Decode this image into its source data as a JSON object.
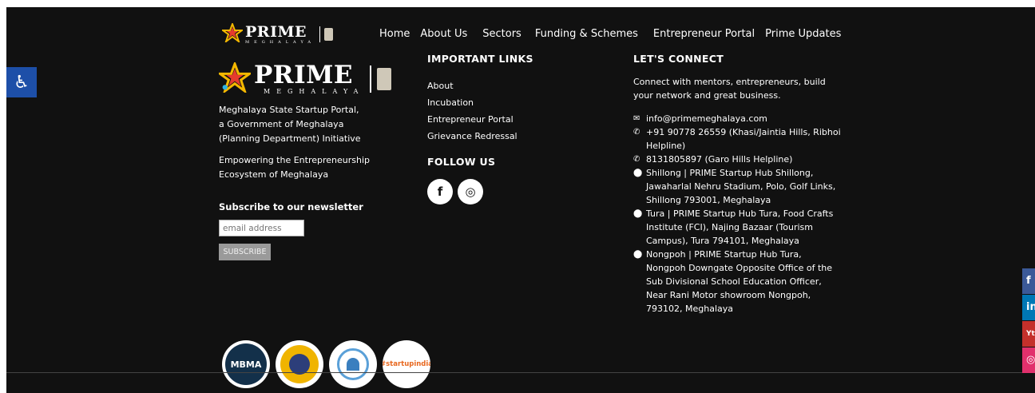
{
  "brand": {
    "name": "PRIME",
    "sub": "MEGHALAYA"
  },
  "nav": {
    "items": [
      "Home",
      "About Us",
      "Sectors",
      "Funding & Schemes",
      "Entrepreneur Portal",
      "Prime Updates"
    ]
  },
  "about": {
    "line1": "Meghalaya State Startup Portal,",
    "line2": "a Government of Meghalaya",
    "line3": "(Planning Department) Initiative",
    "tag1": "Empowering the Entrepreneurship",
    "tag2": "Ecosystem of Meghalaya"
  },
  "newsletter": {
    "title": "Subscribe to our newsletter",
    "placeholder": "email address",
    "button": "SUBSCRIBE"
  },
  "important_links": {
    "heading": "IMPORTANT LINKS",
    "items": [
      "About",
      "Incubation",
      "Entrepreneur Portal",
      "Grievance Redressal"
    ]
  },
  "follow": {
    "heading": "FOLLOW US",
    "facebook_glyph": "f",
    "instagram_glyph": "◎"
  },
  "connect": {
    "heading": "LET'S CONNECT",
    "intro1": "Connect with mentors, entrepreneurs, build",
    "intro2": "your network and great business.",
    "email": "info@primemeghalaya.com",
    "phone1a": "+91 90778 26559 (Khasi/Jaintia Hills, Ribhoi",
    "phone1b": "Helpline)",
    "phone2": "8131805897 (Garo Hills Helpline)",
    "addr1": [
      "Shillong | PRIME Startup Hub Shillong,",
      "Jawaharlal Nehru Stadium, Polo, Golf Links,",
      "Shillong 793001, Meghalaya"
    ],
    "addr2": [
      "Tura | PRIME Startup Hub Tura, Food Crafts",
      "Institute (FCI), Najing Bazaar (Tourism",
      "Campus), Tura 794101, Meghalaya"
    ],
    "addr3": [
      "Nongpoh | PRIME Startup Hub Tura,",
      "Nongpoh Downgate Opposite Office of the",
      "Sub Divisional School Education Officer,",
      "Near Rani Motor showroom Nongpoh,",
      "793102, Meghalaya"
    ]
  },
  "partners": {
    "mbma": "MBMA",
    "startupindia": "#startupindia"
  },
  "side_social": [
    "f",
    "in",
    "Yt",
    "◎"
  ],
  "colors": {
    "background": "#111111",
    "accessibility": "#1d4fa8",
    "facebook": "#3b5998",
    "linkedin": "#0077b5",
    "youtube": "#c4302b",
    "instagram": "#e1306c"
  }
}
